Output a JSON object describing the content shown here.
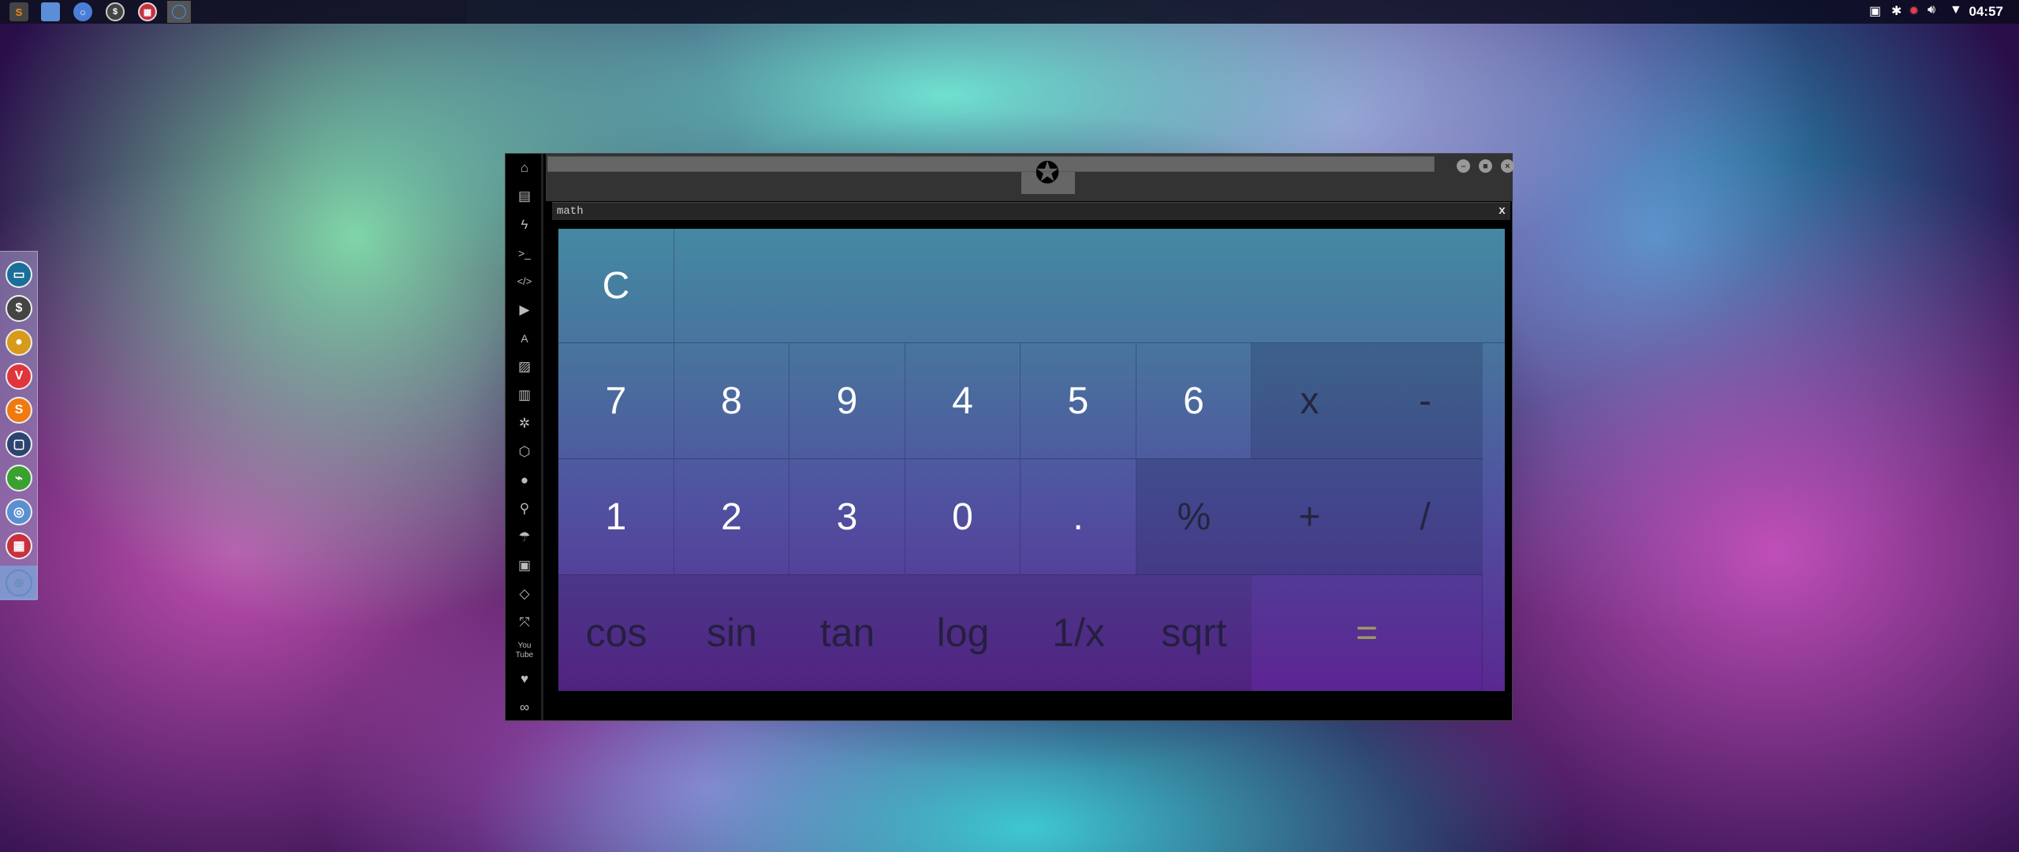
{
  "taskbar": {
    "apps": [
      {
        "icon": "sublime-icon",
        "color": "#f08a1d"
      },
      {
        "icon": "folder-icon",
        "color": "#5a8fd8"
      },
      {
        "icon": "chromium-icon",
        "color": "#4a7fd8"
      },
      {
        "icon": "terminal-icon",
        "color": "#444"
      },
      {
        "icon": "calculator-icon",
        "color": "#c83040"
      },
      {
        "icon": "active-window-icon",
        "color": "#555"
      }
    ],
    "tray": [
      "image-icon",
      "bluetooth-icon",
      "alert-icon",
      "volume-icon",
      "wifi-icon"
    ],
    "clock": "04:57"
  },
  "dock": {
    "items": [
      {
        "icon": "files-icon",
        "color": "#1a6f9a"
      },
      {
        "icon": "terminal-icon",
        "glyph": "$",
        "color": "#444"
      },
      {
        "icon": "screenshot-icon",
        "color": "#d89a1a"
      },
      {
        "icon": "vivaldi-icon",
        "glyph": "V",
        "color": "#e0353c"
      },
      {
        "icon": "sublime-icon",
        "glyph": "S",
        "color": "#f07a10"
      },
      {
        "icon": "image-editor-icon",
        "color": "#2e4470"
      },
      {
        "icon": "system-monitor-icon",
        "color": "#3aa030"
      },
      {
        "icon": "chrome-icon",
        "color": "#5a90d0"
      },
      {
        "icon": "calculator-icon",
        "color": "#c83040"
      },
      {
        "icon": "globe-icon",
        "color": "#6aa0d0"
      }
    ]
  },
  "window": {
    "sidebar": [
      "home-icon",
      "document-icon",
      "bolt-icon",
      "terminal-icon",
      "code-icon",
      "play-icon",
      "translate-icon",
      "image-icon",
      "news-icon",
      "empire-icon",
      "network-icon",
      "globe-icon",
      "search-icon",
      "umbrella-icon",
      "contacts-icon",
      "link-icon",
      "expand-icon",
      "youtube-icon",
      "heart-icon",
      "cloud-icon"
    ],
    "tab": {
      "title": "math",
      "close": "x"
    },
    "calculator": {
      "clear": "C",
      "display": "",
      "row1": [
        "7",
        "8",
        "9",
        "4",
        "5",
        "6"
      ],
      "row1_ops": [
        "x",
        "-"
      ],
      "row2": [
        "1",
        "2",
        "3",
        "0",
        "."
      ],
      "row2_ops": [
        "%",
        "+",
        "/"
      ],
      "functions": [
        "cos",
        "sin",
        "tan",
        "log",
        "1/x",
        "sqrt"
      ],
      "equals": "="
    }
  }
}
